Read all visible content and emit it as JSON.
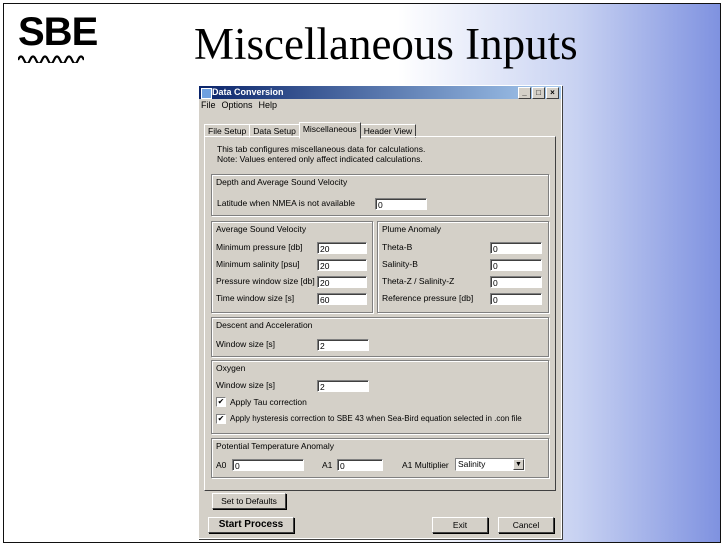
{
  "slide": {
    "title": "Miscellaneous Inputs",
    "logo": "SBE"
  },
  "window": {
    "title": "Data Conversion",
    "controls": [
      "_",
      "□",
      "×"
    ],
    "menu": [
      "File",
      "Options",
      "Help"
    ],
    "tabs": [
      "File Setup",
      "Data Setup",
      "Miscellaneous",
      "Header View"
    ],
    "intro_line1": "This tab configures miscellaneous data for calculations.",
    "intro_line2": "Note: Values entered only affect indicated calculations."
  },
  "depth": {
    "title": "Depth and Average Sound Velocity",
    "latitude_label": "Latitude when NMEA is not available",
    "latitude_value": "0"
  },
  "sound_velocity": {
    "title": "Average Sound Velocity",
    "min_pressure_label": "Minimum pressure [db]",
    "min_pressure": "20",
    "min_salinity_label": "Minimum salinity [psu]",
    "min_salinity": "20",
    "pressure_window_label": "Pressure window size [db]",
    "pressure_window": "20",
    "time_window_label": "Time window size [s]",
    "time_window": "60"
  },
  "plume": {
    "title": "Plume Anomaly",
    "theta_b_label": "Theta-B",
    "theta_b": "0",
    "salinity_b_label": "Salinity-B",
    "salinity_b": "0",
    "theta_z_label": "Theta-Z / Salinity-Z",
    "theta_z": "0",
    "ref_pressure_label": "Reference pressure [db]",
    "ref_pressure": "0"
  },
  "descent": {
    "title": "Descent and Acceleration",
    "window_label": "Window size [s]",
    "window_value": "2"
  },
  "oxygen": {
    "title": "Oxygen",
    "window_label": "Window size [s]",
    "window_value": "2",
    "tau_label": "Apply Tau correction",
    "tau_checked": true,
    "hysteresis_label": "Apply hysteresis correction to SBE 43 when Sea-Bird equation selected in .con file",
    "hysteresis_checked": true
  },
  "temp_anomaly": {
    "title": "Potential Temperature Anomaly",
    "a0_label": "A0",
    "a0_value": "0",
    "a1_label": "A1",
    "a1_value": "0",
    "multiplier_label": "A1 Multiplier",
    "multiplier_value": "Salinity"
  },
  "buttons": {
    "defaults": "Set to Defaults",
    "start": "Start Process",
    "exit": "Exit",
    "cancel": "Cancel"
  }
}
